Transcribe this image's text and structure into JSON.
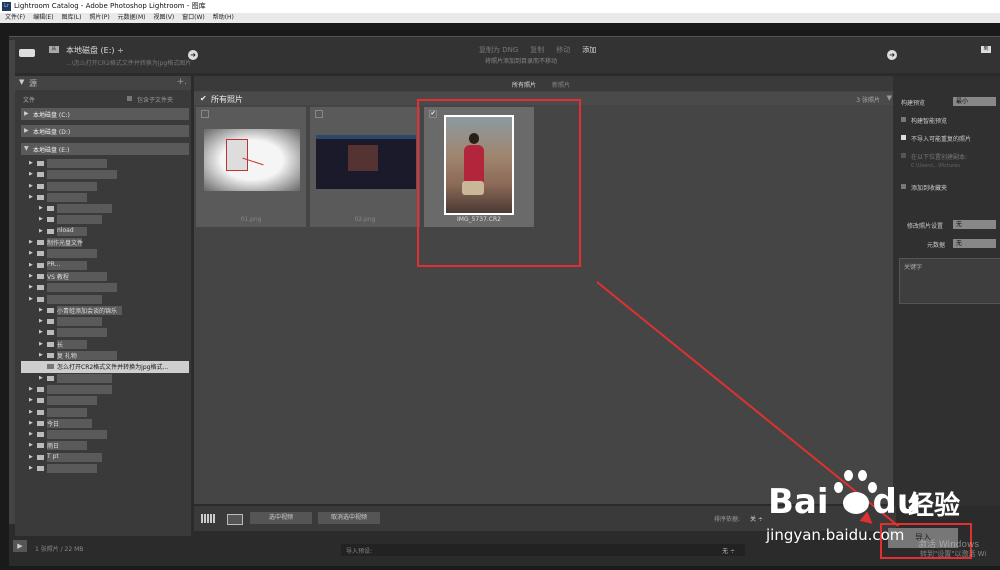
{
  "window": {
    "title": "Lightroom Catalog - Adobe Photoshop Lightroom - 图库",
    "app_icon": "Lr"
  },
  "menubar": [
    "文件(F)",
    "编辑(E)",
    "图库(L)",
    "照片(P)",
    "元数据(M)",
    "视图(V)",
    "窗口(W)",
    "帮助(H)"
  ],
  "source": {
    "from_badge": "从",
    "from_label": "本地磁盘 (E:) ÷",
    "from_path": "...\\怎么打开CR2格式文件并转换为jpg格式图片",
    "to_badge": "到"
  },
  "modes": {
    "items": [
      {
        "label": "复制为 DNG",
        "active": false
      },
      {
        "label": "复制",
        "active": false
      },
      {
        "label": "移动",
        "active": false
      },
      {
        "label": "添加",
        "active": true
      }
    ],
    "description": "将照片添加到目录而不移动"
  },
  "left_panel": {
    "header": "源",
    "plus": "+.",
    "files_label": "文件",
    "include_subfolders": "包含子文件夹",
    "volumes": [
      {
        "label": "本地磁盘 (C:)",
        "expanded": false
      },
      {
        "label": "本地磁盘 (D:)",
        "expanded": false
      },
      {
        "label": "本地磁盘 (E:)",
        "expanded": true
      }
    ],
    "tree": [
      {
        "indent": 1,
        "label": ""
      },
      {
        "indent": 1,
        "label": ""
      },
      {
        "indent": 1,
        "label": ""
      },
      {
        "indent": 1,
        "label": ""
      },
      {
        "indent": 2,
        "label": ""
      },
      {
        "indent": 2,
        "label": ""
      },
      {
        "indent": 2,
        "label": "nload"
      },
      {
        "indent": 1,
        "label": "制作光盘文件"
      },
      {
        "indent": 1,
        "label": ""
      },
      {
        "indent": 1,
        "label": "PR..."
      },
      {
        "indent": 1,
        "label": "VS              教程"
      },
      {
        "indent": 1,
        "label": ""
      },
      {
        "indent": 1,
        "label": ""
      },
      {
        "indent": 2,
        "label": "     小青蛙添加会谈的锦乐"
      },
      {
        "indent": 2,
        "label": ""
      },
      {
        "indent": 2,
        "label": ""
      },
      {
        "indent": 2,
        "label": "长"
      },
      {
        "indent": 2,
        "label": "复     礼物"
      },
      {
        "indent": 2,
        "label": "怎么打开CR2格式文件并转换为jpg格式...",
        "selected": true
      },
      {
        "indent": 2,
        "label": ""
      },
      {
        "indent": 1,
        "label": ""
      },
      {
        "indent": 1,
        "label": ""
      },
      {
        "indent": 1,
        "label": ""
      },
      {
        "indent": 1,
        "label": "今日"
      },
      {
        "indent": 1,
        "label": ""
      },
      {
        "indent": 1,
        "label": "雨日"
      },
      {
        "indent": 1,
        "label": "T        pt"
      },
      {
        "indent": 1,
        "label": ""
      }
    ]
  },
  "center": {
    "tabs": [
      {
        "label": "所有照片",
        "active": true
      },
      {
        "label": "新照片",
        "active": false
      }
    ],
    "header_label": "所有照片",
    "photo_count": "3 张照片",
    "photos": [
      {
        "filename": "01.png",
        "checked": false
      },
      {
        "filename": "02.png",
        "checked": false
      },
      {
        "filename": "IMG_5737.CR2",
        "checked": true
      }
    ],
    "buttons": {
      "check_all": "选中视频",
      "uncheck_all": "取消选中视频"
    },
    "sort_label": "排序依据:",
    "sort_value": "关 ÷"
  },
  "right_panel": {
    "build_previews_label": "构建预览",
    "build_previews_value": "最小",
    "build_smart_previews": "构建智能预览",
    "dont_import_duplicates": "不导入可能重复的照片",
    "second_copy_label": "在以下位置创建副本:",
    "second_copy_path": "C:\\Users\\...\\Pictures",
    "add_to_collection": "添加到收藏夹",
    "develop_settings_label": "修改照片设置",
    "develop_settings_value": "无",
    "metadata_label": "元数据",
    "metadata_value": "无",
    "keywords_label": "关键字"
  },
  "status": {
    "play_icon": "▶",
    "info": "1 张照片 / 22 MB",
    "preset_label": "导入预设:",
    "preset_value": "无 ÷"
  },
  "import_button": "导入",
  "overlay": {
    "activate_line1": "激活 Windows",
    "activate_line2": "转到\"设置\"以激活 Wi",
    "watermark_brand": "Bai",
    "watermark_brand_du": "du",
    "watermark_cn": "经验",
    "watermark_url": "jingyan.baidu.com"
  },
  "colors": {
    "annotation_red": "#e03030",
    "selected_row": "#cfcfcf",
    "panel_bg": "#3a3a3a"
  }
}
